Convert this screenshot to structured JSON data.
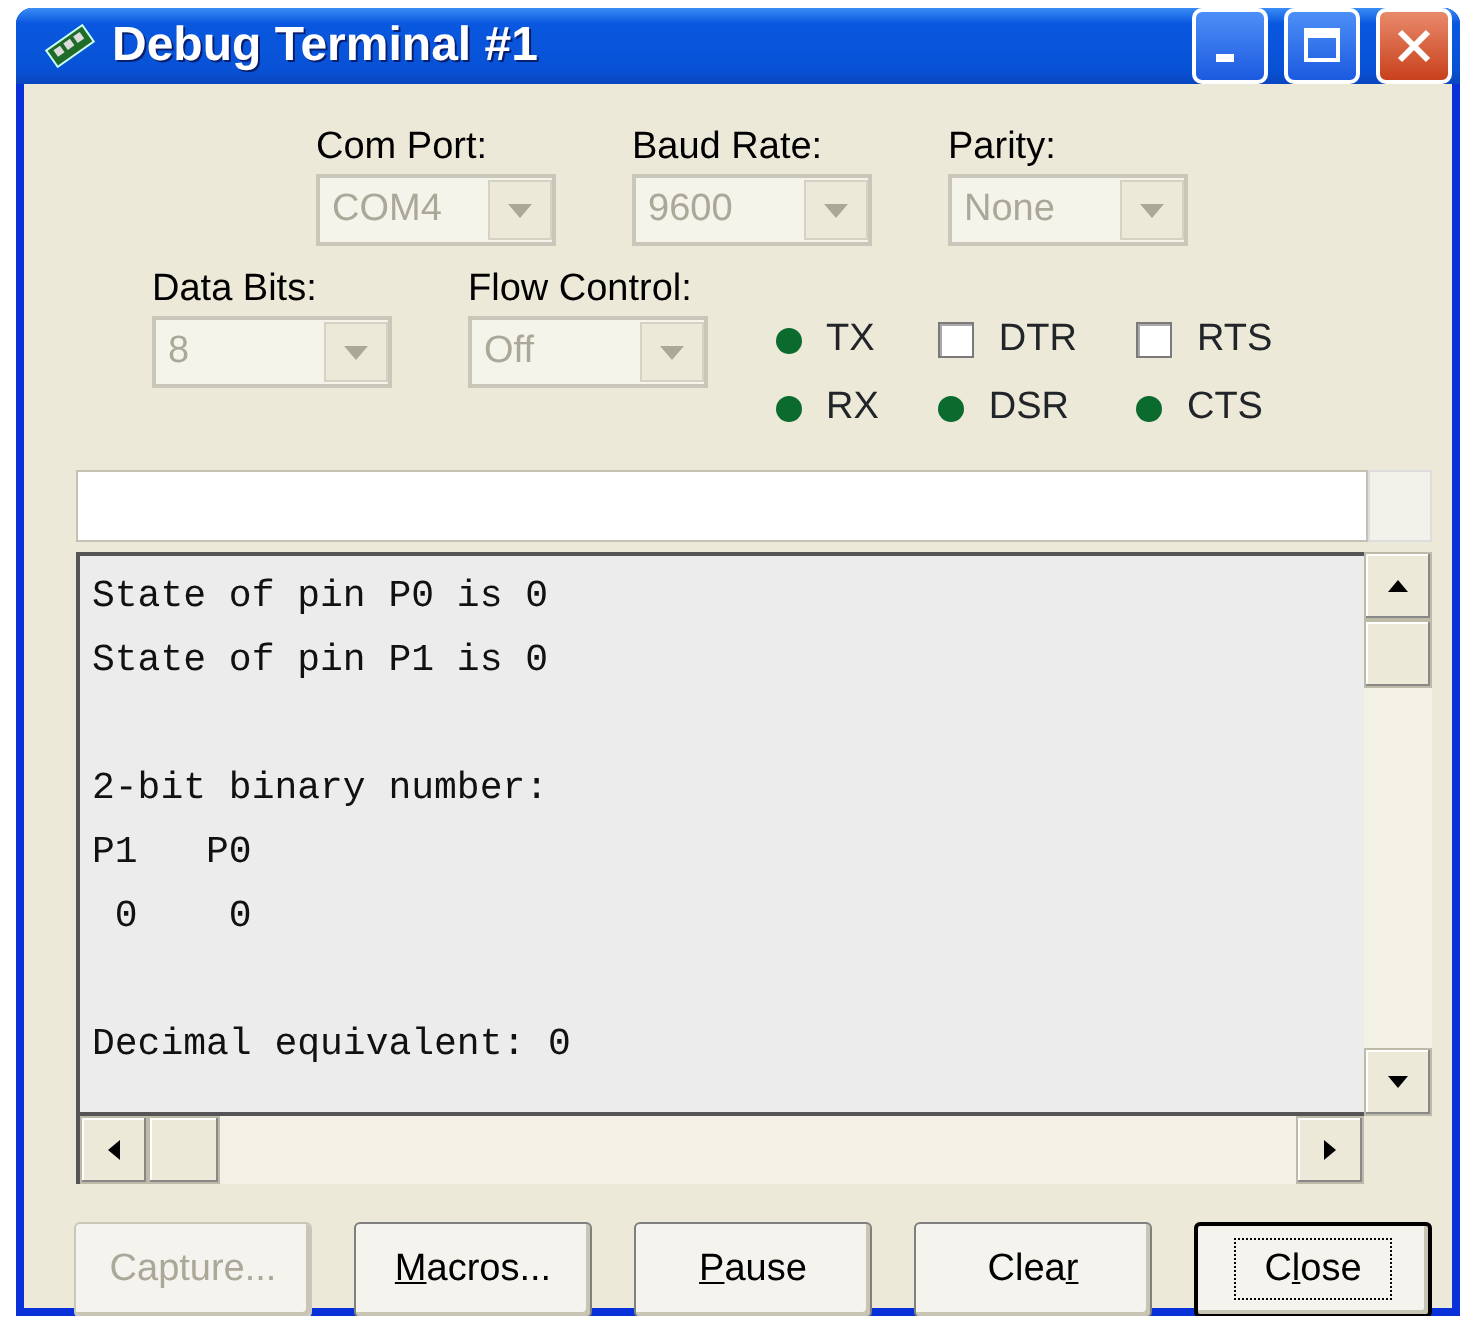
{
  "window": {
    "title": "Debug Terminal #1"
  },
  "port_settings": [
    {
      "label": "Com Port:",
      "value": "COM4",
      "disabled": true
    },
    {
      "label": "Baud Rate:",
      "value": "9600",
      "disabled": true
    },
    {
      "label": "Parity:",
      "value": "None",
      "disabled": true
    }
  ],
  "line_settings": [
    {
      "label": "Data Bits:",
      "value": "8",
      "disabled": true
    },
    {
      "label": "Flow Control:",
      "value": "Off",
      "disabled": true
    }
  ],
  "signals": [
    {
      "label": "TX",
      "kind": "led",
      "color": "#0b6b2f"
    },
    {
      "label": "RX",
      "kind": "led",
      "color": "#0b6b2f"
    },
    {
      "label": "DTR",
      "kind": "checkbox",
      "checked": false
    },
    {
      "label": "DSR",
      "kind": "led",
      "color": "#0b6b2f"
    },
    {
      "label": "RTS",
      "kind": "checkbox",
      "checked": false
    },
    {
      "label": "CTS",
      "kind": "led",
      "color": "#0b6b2f"
    }
  ],
  "terminal": {
    "lines": [
      {
        "kind": "text",
        "text": "State of pin P0 is 0"
      },
      {
        "kind": "text",
        "text": "State of pin P1 is 0"
      },
      {
        "kind": "blank"
      },
      {
        "kind": "text",
        "text": "2-bit binary number:"
      },
      {
        "kind": "text",
        "text": "P1   P0"
      },
      {
        "kind": "text",
        "text": " 0    0"
      },
      {
        "kind": "blank"
      },
      {
        "kind": "text",
        "text": "Decimal equivalent: 0"
      }
    ]
  },
  "buttons": [
    {
      "label": "Capture...",
      "disabled": true,
      "default": false
    },
    {
      "access_key": "M",
      "label_end": "acros...",
      "disabled": false,
      "default": false
    },
    {
      "access_key": "P",
      "label_end": "ause",
      "disabled": false,
      "default": false
    },
    {
      "label_start": "Clea",
      "access_key": "r",
      "disabled": false,
      "default": false
    },
    {
      "label_start": "C",
      "access_key": "l",
      "label_end": "ose",
      "disabled": false,
      "default": true
    }
  ]
}
